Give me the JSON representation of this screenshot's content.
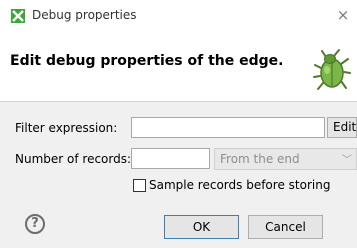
{
  "window": {
    "title": "Debug properties",
    "close_glyph": "×"
  },
  "header": {
    "message": "Edit debug properties of the edge.",
    "icon": "bug-icon"
  },
  "form": {
    "filter_label": "Filter expression:",
    "filter_value": "",
    "edit_button": "Edit",
    "records_label": "Number of records:",
    "records_value": "",
    "records_mode": "From the end",
    "sample_label": "Sample records before storing",
    "sample_checked": false
  },
  "buttons": {
    "ok": "OK",
    "cancel": "Cancel",
    "help_glyph": "?"
  },
  "colors": {
    "app_icon_green": "#3aa838",
    "bug_green": "#7ab648"
  }
}
